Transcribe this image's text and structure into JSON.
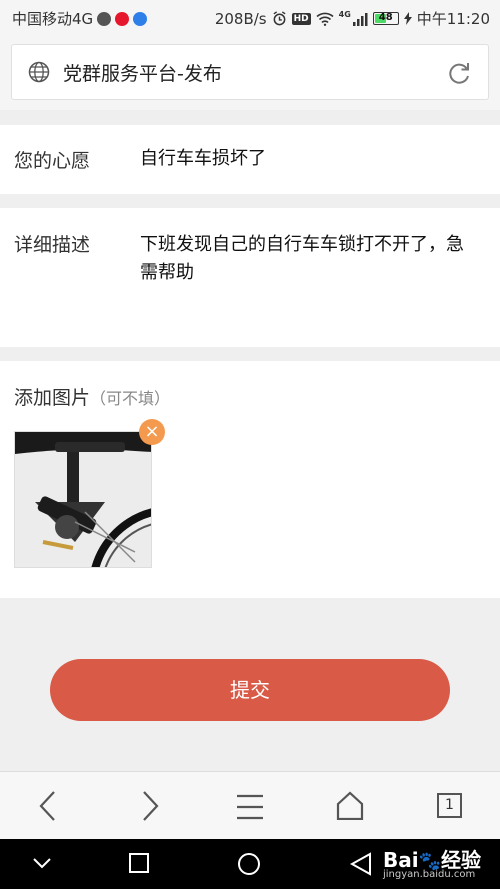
{
  "status_bar": {
    "carrier": "中国移动4G",
    "speed": "208B/s",
    "battery": "48",
    "time": "中午11:20",
    "network_label": "4G"
  },
  "address_bar": {
    "title": "党群服务平台-发布"
  },
  "form": {
    "wish_label": "您的心愿",
    "wish_value": "自行车车损坏了",
    "detail_label": "详细描述",
    "detail_value": "下班发现自己的自行车车锁打不开了，急需帮助",
    "image_label": "添加图片",
    "image_hint": "（可不填）",
    "remove_symbol": "×"
  },
  "submit_label": "提交",
  "toolbar": {
    "tab_count": "1"
  },
  "watermark": {
    "brand": "Bai",
    "brand2": "经验",
    "site": "jingyan.baidu.com"
  },
  "colors": {
    "submit": "#d85a47",
    "remove_badge": "#f39a4e",
    "background": "#efefef"
  }
}
